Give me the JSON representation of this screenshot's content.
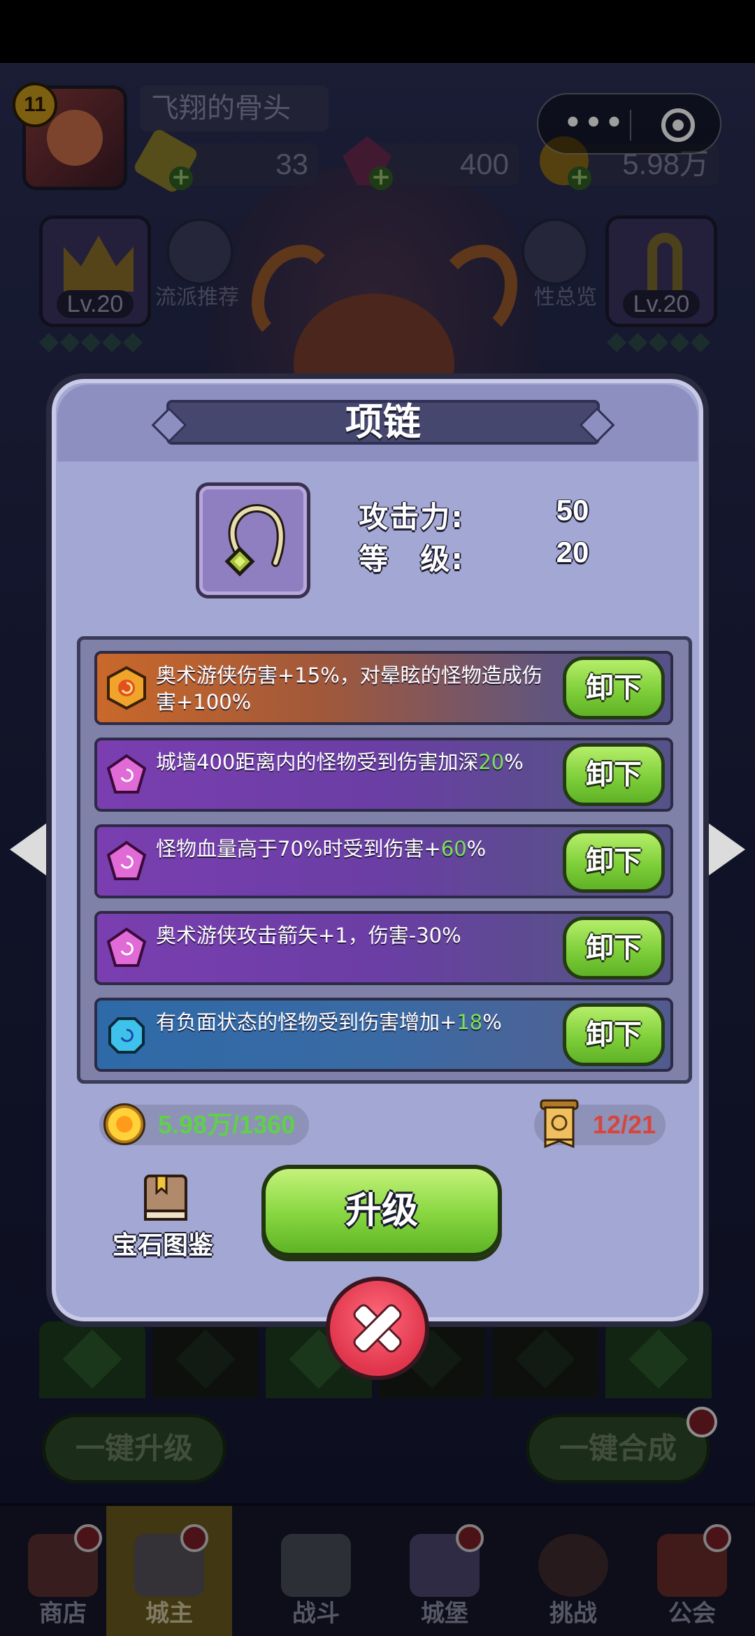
{
  "player": {
    "level": "11",
    "name": "飞翔的骨头"
  },
  "currencies": {
    "gold_bars": "33",
    "gems": "400",
    "coins": "5.98万"
  },
  "top_buttons": {
    "build_recommend": "流派推荐",
    "overview": "性总览"
  },
  "slots": {
    "left_level": "Lv.20",
    "right_level": "Lv.20"
  },
  "modal": {
    "title": "项链",
    "stats": [
      {
        "label": "攻击力:",
        "value": "50"
      },
      {
        "label": "等　级:",
        "value": "20"
      }
    ],
    "gems": [
      {
        "color": "orange",
        "text_before": "奥术游侠伤害+15%，对晕眩的怪物造成伤害+100%",
        "highlight": "",
        "text_after": "",
        "button": "卸下"
      },
      {
        "color": "purple",
        "text_before": "城墙400距离内的怪物受到伤害加深",
        "highlight": "20",
        "text_after": "%",
        "button": "卸下"
      },
      {
        "color": "purple",
        "text_before": "怪物血量高于70%时受到伤害+",
        "highlight": "60",
        "text_after": "%",
        "button": "卸下"
      },
      {
        "color": "purple",
        "text_before": "奥术游侠攻击箭矢+1，伤害-30%",
        "highlight": "",
        "text_after": "",
        "button": "卸下"
      },
      {
        "color": "blue",
        "text_before": "有负面状态的怪物受到伤害增加+",
        "highlight": "18",
        "text_after": "%",
        "button": "卸下"
      }
    ],
    "cost": "5.98万/1360",
    "scrolls": "12/21",
    "codex_label": "宝石图鉴",
    "upgrade_label": "升级"
  },
  "bottom_buttons": {
    "upgrade_all": "一键升级",
    "merge_all": "一键合成"
  },
  "tabs": [
    {
      "label": "商店",
      "active": false
    },
    {
      "label": "城主",
      "active": true
    },
    {
      "label": "战斗",
      "active": false
    },
    {
      "label": "城堡",
      "active": false
    },
    {
      "label": "挑战",
      "active": false
    },
    {
      "label": "公会",
      "active": false
    }
  ],
  "colors": {
    "highlight_green": "#7be05a",
    "cost_green": "#5fd148",
    "scroll_red": "#d6463c",
    "button_green": "#8bd944",
    "close_red": "#e0354c"
  }
}
